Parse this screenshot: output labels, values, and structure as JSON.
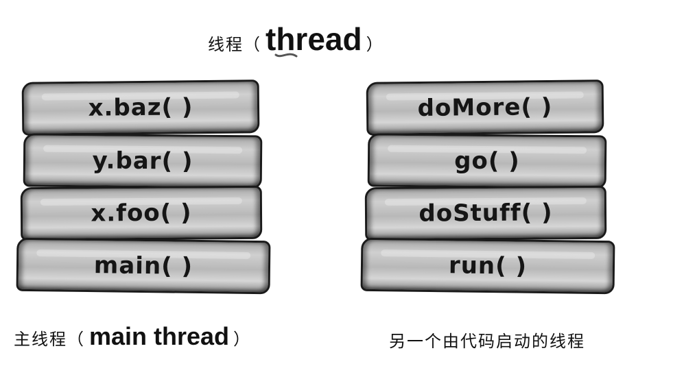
{
  "top_title": {
    "cn": "线程（",
    "en": "thread",
    "close": "）"
  },
  "left_stack": {
    "frames": [
      "x.baz( )",
      "y.bar( )",
      "x.foo( )",
      "main( )"
    ]
  },
  "right_stack": {
    "frames": [
      "doMore( )",
      "go( )",
      "doStuff( )",
      "run( )"
    ]
  },
  "left_caption": {
    "cn": "主线程（",
    "en": "main thread",
    "close": "）"
  },
  "right_caption": {
    "text": "另一个由代码启动的线程"
  }
}
